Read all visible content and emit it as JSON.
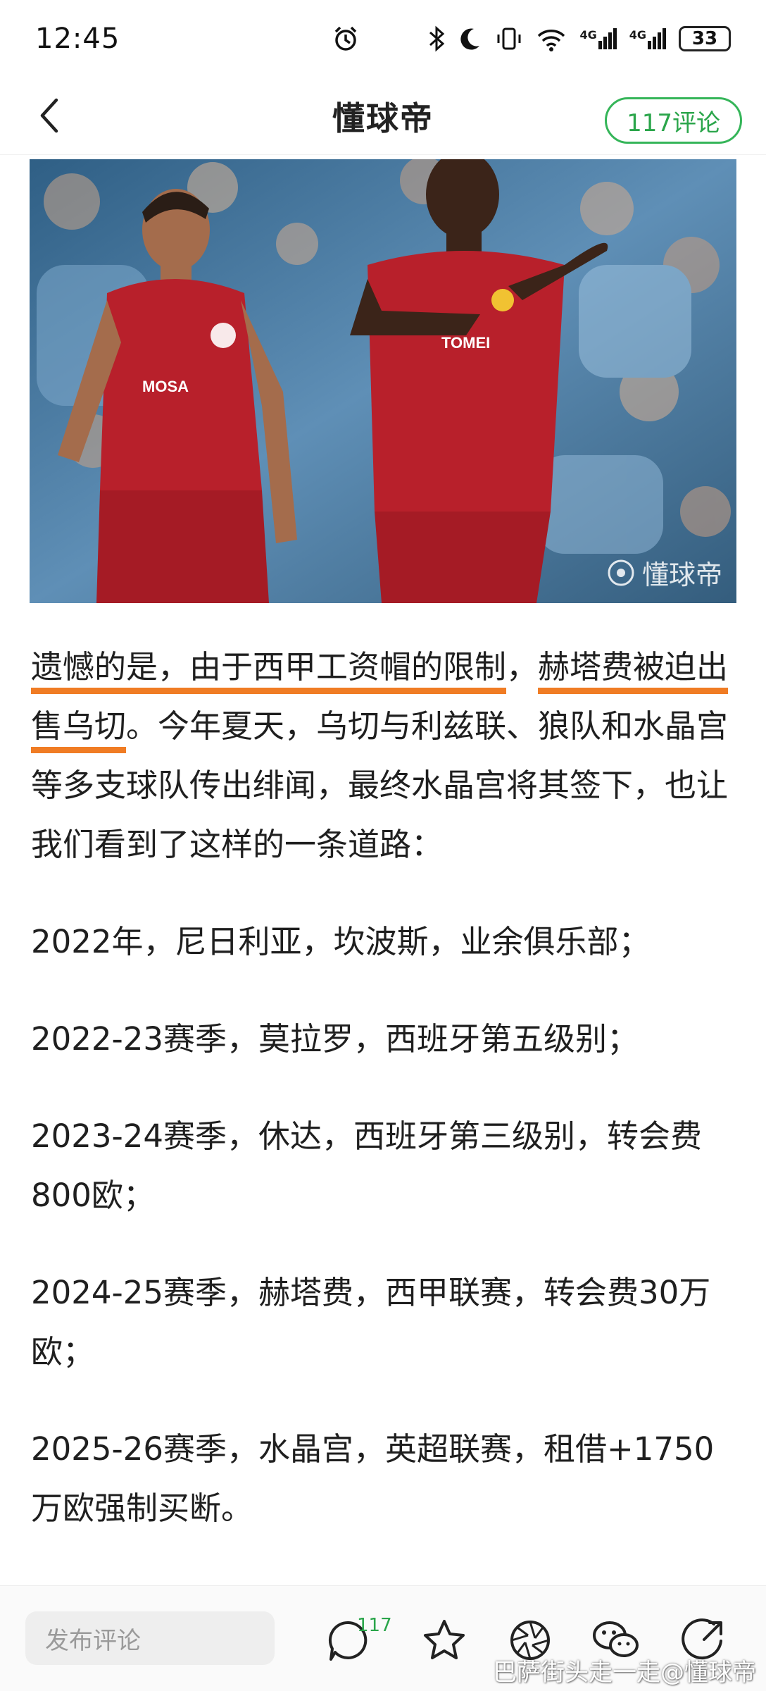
{
  "status_bar": {
    "time": "12:45",
    "icons": [
      "alarm-icon",
      "bluetooth-icon",
      "moon-icon",
      "vibrate-icon",
      "wifi-icon",
      "signal-4g-icon",
      "signal-4g-icon"
    ],
    "battery": "33",
    "network_label": "4G"
  },
  "header": {
    "title": "懂球帝",
    "comments_button": "117评论"
  },
  "hero": {
    "watermark": "懂球帝"
  },
  "article": {
    "p1_hl1": "遗憾的是，由于西甲工资帽的限制",
    "p1_mid": "，",
    "p1_hl2": "赫塔费被迫出售乌切",
    "p1_rest": "。今年夏天，乌切与利兹联、狼队和水晶宫等多支球队传出绯闻，最终水晶宫将其签下，也让我们看到了这样的一条道路：",
    "p2": "2022年，尼日利亚，坎波斯，业余俱乐部；",
    "p3": "2022-23赛季，莫拉罗，西班牙第五级别；",
    "p4": "2023-24赛季，休达，西班牙第三级别，转会费800欧；",
    "p5": "2024-25赛季，赫塔费，西甲联赛，转会费30万欧；",
    "p6": "2025-26赛季，水晶宫，英超联赛，租借+1750万欧强制买断。"
  },
  "bottom_bar": {
    "comment_placeholder": "发布评论",
    "comment_count": "117",
    "credit": "巴萨街头走一走@懂球帝"
  },
  "colors": {
    "accent_green": "#2aa54a",
    "highlight_orange": "#f07c24",
    "jersey_red": "#b8202b"
  }
}
